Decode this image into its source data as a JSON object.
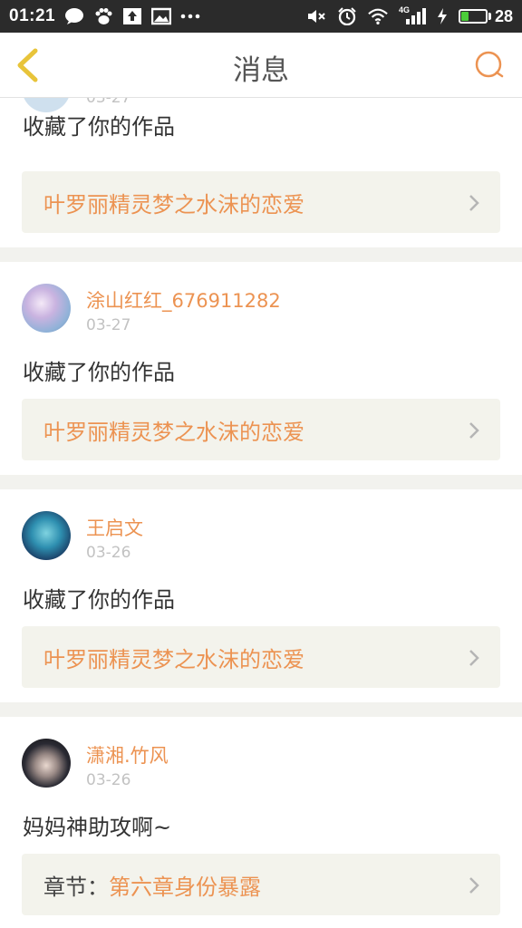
{
  "status_bar": {
    "time": "01:21",
    "network": "4G",
    "battery_percent": "28",
    "battery_level": 0.28
  },
  "header": {
    "title": "消息"
  },
  "messages": [
    {
      "username": "",
      "date": "03-27",
      "text": "收藏了你的作品",
      "work_prefix": "",
      "work_title": "叶罗丽精灵梦之水沫的恋爱"
    },
    {
      "username": "涂山红红_676911282",
      "date": "03-27",
      "text": "收藏了你的作品",
      "work_prefix": "",
      "work_title": "叶罗丽精灵梦之水沫的恋爱"
    },
    {
      "username": "王启文",
      "date": "03-26",
      "text": "收藏了你的作品",
      "work_prefix": "",
      "work_title": "叶罗丽精灵梦之水沫的恋爱"
    },
    {
      "username": "潇湘.竹风",
      "date": "03-26",
      "text": "妈妈神助攻啊~",
      "work_prefix": "章节：",
      "work_title": "第六章身份暴露"
    }
  ],
  "colors": {
    "accent": "#ec9352",
    "back_arrow": "#e8c43a",
    "card_bg": "#f3f3ec",
    "divider": "#f2f2ee"
  },
  "icons": {
    "back": "chevron-left-icon",
    "search": "search-icon",
    "item_arrow": "chevron-right-icon"
  }
}
